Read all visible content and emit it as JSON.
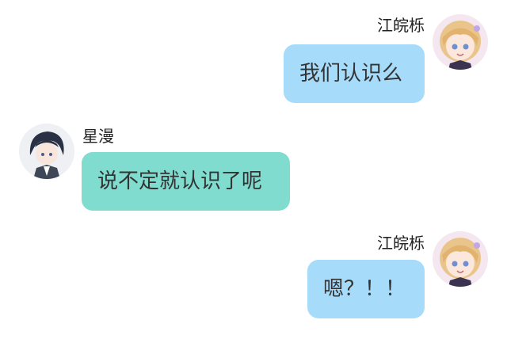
{
  "messages": [
    {
      "sender": "江皖栎",
      "text": "我们认识么",
      "side": "right",
      "avatar": "anime-girl-blonde-avatar"
    },
    {
      "sender": "星漫",
      "text": "说不定就认识了呢",
      "side": "left",
      "avatar": "anime-boy-dark-hair-avatar"
    },
    {
      "sender": "江皖栎",
      "text": "嗯？！！",
      "side": "right",
      "avatar": "anime-girl-blonde-avatar"
    }
  ],
  "colors": {
    "right_bubble": "#a6dbfa",
    "left_bubble": "#80dccf",
    "background": "#ffffff"
  }
}
